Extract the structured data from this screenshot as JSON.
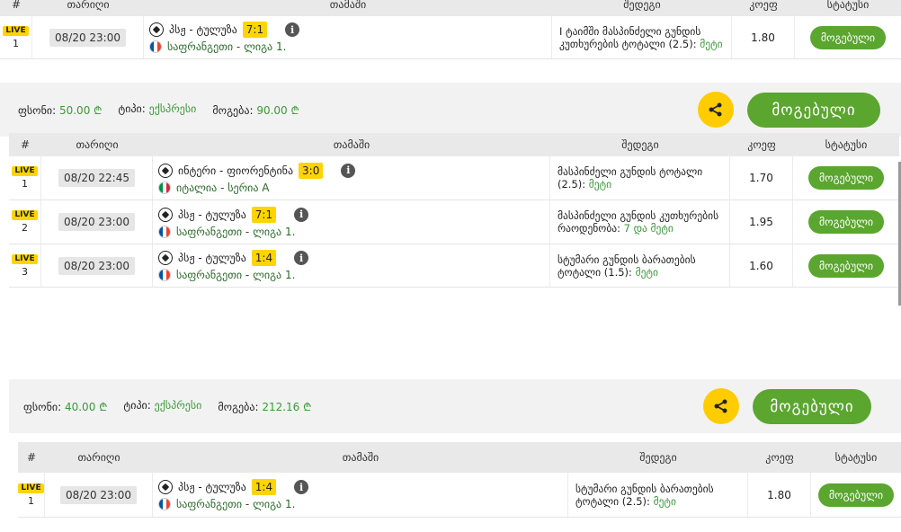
{
  "headers": {
    "num": "#",
    "date": "თარიღი",
    "game": "თამაში",
    "bet": "შედეგი",
    "odds": "კოეფ",
    "status": "სტატუსი"
  },
  "live_label": "LIVE",
  "win_label": "მოგებული",
  "info_glyph": "i",
  "summary_labels": {
    "stake": "ფსონი:",
    "type": "ტიპი:",
    "win": "მოგება:"
  },
  "colors": {
    "accent_green": "#5aa62f",
    "live_yellow": "#ffd400",
    "share_yellow": "#ffcc00"
  },
  "icons": [
    "ball-icon",
    "info-icon",
    "flag-icon",
    "share-icon"
  ],
  "tickets": [
    {
      "rows": [
        {
          "num": "1",
          "date": "08/20 23:00",
          "match": "პსჟ - ტულუზა",
          "score": "7:1",
          "league": "საფრანგეთი",
          "division": "ლიგა 1.",
          "flag": "fr",
          "bet_prefix": "I ტაიმში მასპინძელი გუნდის კუთხურების ტოტალი (2.5):",
          "bet_choice": "მეტი",
          "odds": "1.80"
        }
      ],
      "summary": {
        "stake": "50.00 ₾",
        "type": "ექსპრესი",
        "win": "90.00 ₾"
      }
    },
    {
      "rows": [
        {
          "num": "1",
          "date": "08/20 22:45",
          "match": "ინტერი - ფიორენტინა",
          "score": "3:0",
          "league": "იტალია",
          "division": "სერია A",
          "flag": "it",
          "bet_prefix": "მასპინძელი გუნდის ტოტალი (2.5):",
          "bet_choice": "მეტი",
          "odds": "1.70"
        },
        {
          "num": "2",
          "date": "08/20 23:00",
          "match": "პსჟ - ტულუზა",
          "score": "7:1",
          "league": "საფრანგეთი",
          "division": "ლიგა 1.",
          "flag": "fr",
          "bet_prefix": "მასპინძელი გუნდის კუთხურების რაოდენობა:",
          "bet_choice": "7 და მეტი",
          "odds": "1.95"
        },
        {
          "num": "3",
          "date": "08/20 23:00",
          "match": "პსჟ - ტულუზა",
          "score": "1:4",
          "league": "საფრანგეთი",
          "division": "ლიგა 1.",
          "flag": "fr",
          "bet_prefix": "სტუმარი გუნდის ბარათების ტოტალი (1.5):",
          "bet_choice": "მეტი",
          "odds": "1.60"
        }
      ],
      "summary": {
        "stake": "40.00 ₾",
        "type": "ექსპრესი",
        "win": "212.16 ₾"
      }
    },
    {
      "rows": [
        {
          "num": "1",
          "date": "08/20 23:00",
          "match": "პსჟ - ტულუზა",
          "score": "1:4",
          "league": "საფრანგეთი",
          "division": "ლიგა 1.",
          "flag": "fr",
          "bet_prefix": "სტუმარი გუნდის ბარათების ტოტალი (2.5):",
          "bet_choice": "მეტი",
          "odds": "1.80"
        }
      ]
    }
  ]
}
